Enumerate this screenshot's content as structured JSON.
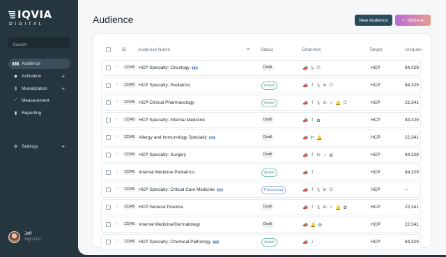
{
  "brand": {
    "name": "IQVIA",
    "sub": "DIGITAL"
  },
  "sidebar": {
    "search_placeholder": "Search",
    "items": [
      {
        "label": "Audience",
        "icon": "audience-icon",
        "glyph": "▮▮▮",
        "active": true,
        "expandable": false
      },
      {
        "label": "Activation",
        "icon": "activation-icon",
        "glyph": "◆",
        "active": false,
        "expandable": true
      },
      {
        "label": "Monetization",
        "icon": "dollar-icon",
        "glyph": "$",
        "active": false,
        "expandable": true
      },
      {
        "label": "Measurement",
        "icon": "trend-icon",
        "glyph": "⟋",
        "active": false,
        "expandable": false
      },
      {
        "label": "Reporting",
        "icon": "bar-chart-icon",
        "glyph": "▮",
        "active": false,
        "expandable": false
      }
    ],
    "settings": {
      "label": "Settings",
      "icon": "gear-icon",
      "glyph": "⚙",
      "expandable": true
    },
    "user": {
      "name": "Jeff",
      "action": "Sign Out"
    }
  },
  "header": {
    "title": "Audience",
    "new_button": "New Audience",
    "ai_button": "IQVIA AI"
  },
  "table": {
    "columns": {
      "id": "ID",
      "name": "Audience Name",
      "status": "Status",
      "channels": "Channels",
      "target": "Target",
      "uniques": "Uniques"
    },
    "rows": [
      {
        "id": "12345",
        "name": "HCP Specialty: Oncology",
        "aud": true,
        "status": "Draft",
        "channels": [
          "megaphone",
          "x",
          "power"
        ],
        "target": "HCP",
        "uniques": "84,329"
      },
      {
        "id": "12345",
        "name": "HCP Specialty: Pediatrics",
        "aud": false,
        "status": "Active",
        "channels": [
          "megaphone",
          "facebook",
          "x",
          "linkedin",
          "power"
        ],
        "target": "HCP",
        "uniques": "84,329"
      },
      {
        "id": "12345",
        "name": "HCP Clinical Pharmacology",
        "aud": false,
        "status": "Active",
        "channels": [
          "megaphone",
          "facebook",
          "x",
          "linkedin",
          "tiktok",
          "bell",
          "power"
        ],
        "target": "HCP",
        "uniques": "22,341"
      },
      {
        "id": "12345",
        "name": "HCP Specialty: Internal Medicine",
        "aud": false,
        "status": "Draft",
        "channels": [
          "megaphone",
          "facebook",
          "openai"
        ],
        "target": "HCP",
        "uniques": "84,329"
      },
      {
        "id": "12345",
        "name": "Allergy and Immunology Specialty",
        "aud": true,
        "status": "Draft",
        "channels": [
          "megaphone",
          "linkedin",
          "bell"
        ],
        "target": "HCP",
        "uniques": "22,341"
      },
      {
        "id": "12345",
        "name": "HCP Specialty: Surgery",
        "aud": false,
        "status": "Draft",
        "channels": [
          "megaphone",
          "facebook",
          "linkedin",
          "tiktok",
          "openai"
        ],
        "target": "HCP",
        "uniques": "84,329"
      },
      {
        "id": "12345",
        "name": "Internal Medicine Pediatrics",
        "aud": false,
        "status": "Active",
        "channels": [
          "megaphone",
          "facebook"
        ],
        "target": "HCP",
        "uniques": "84,329"
      },
      {
        "id": "12345",
        "name": "HCP Specialty: Critical Care Medicine",
        "aud": true,
        "status": "Processing",
        "channels": [
          "megaphone",
          "facebook",
          "x",
          "linkedin",
          "power"
        ],
        "target": "HCP",
        "uniques": "--"
      },
      {
        "id": "12345",
        "name": "HCP General Practice",
        "aud": false,
        "status": "Draft",
        "channels": [
          "megaphone",
          "facebook",
          "x",
          "linkedin",
          "tiktok",
          "bell",
          "openai"
        ],
        "target": "HCP",
        "uniques": "22,341"
      },
      {
        "id": "12345",
        "name": "Internal Medicine/Dermatology",
        "aud": false,
        "status": "Draft",
        "channels": [
          "megaphone",
          "bell",
          "openai"
        ],
        "target": "HCP",
        "uniques": "22,341"
      },
      {
        "id": "12345",
        "name": "HCP Specialty: Chemical Pathology",
        "aud": true,
        "status": "Active",
        "channels": [
          "megaphone",
          "tiktok"
        ],
        "target": "HCP",
        "uniques": "84,329"
      }
    ]
  },
  "colors": {
    "sidebar": "#26363f",
    "primary": "#2a4b59",
    "active": "#3b9c8e",
    "processing": "#5a86c4",
    "ai_start": "#b66bd8",
    "ai_end": "#e69a8c"
  }
}
